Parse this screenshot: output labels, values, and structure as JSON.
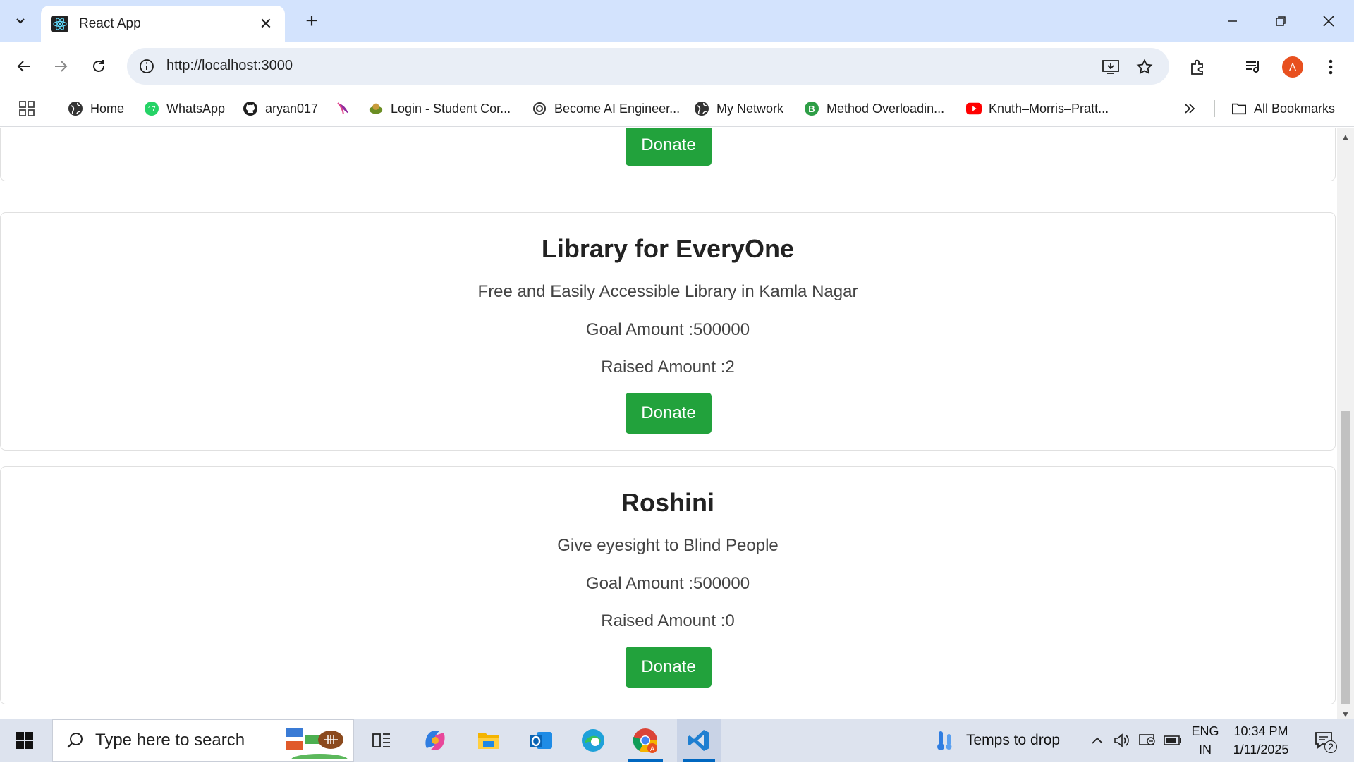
{
  "browser": {
    "tab_title": "React App",
    "url": "http://localhost:3000",
    "profile_initial": "A"
  },
  "bookmarks": {
    "items": [
      {
        "label": "Home",
        "icon": "globe-icon"
      },
      {
        "label": "WhatsApp",
        "icon": "whatsapp-icon"
      },
      {
        "label": "aryan017",
        "icon": "github-icon"
      },
      {
        "label": "",
        "icon": "bird-icon"
      },
      {
        "label": "Login - Student Cor...",
        "icon": "student-portal-icon"
      },
      {
        "label": "Become AI Engineer...",
        "icon": "openai-icon"
      },
      {
        "label": "My Network",
        "icon": "globe-icon"
      },
      {
        "label": "Method Overloadin...",
        "icon": "b-icon"
      },
      {
        "label": "Knuth–Morris–Pratt...",
        "icon": "youtube-icon"
      }
    ],
    "all_bookmarks": "All Bookmarks"
  },
  "campaigns": [
    {
      "title": "",
      "description": "",
      "goal": "",
      "raised": "",
      "donate_label": "Donate"
    },
    {
      "title": "Library for EveryOne",
      "description": "Free and Easily Accessible Library in Kamla Nagar",
      "goal": "Goal Amount :500000",
      "raised": "Raised Amount :2",
      "donate_label": "Donate"
    },
    {
      "title": "Roshini",
      "description": "Give eyesight to Blind People",
      "goal": "Goal Amount :500000",
      "raised": "Raised Amount :0",
      "donate_label": "Donate"
    }
  ],
  "taskbar": {
    "search_placeholder": "Type here to search",
    "weather": "Temps to drop",
    "lang_top": "ENG",
    "lang_bottom": "IN",
    "time": "10:34 PM",
    "date": "1/11/2025",
    "notification_count": "2"
  },
  "colors": {
    "donate_button": "#22a23c",
    "titlebar": "#d3e3fd",
    "taskbar": "#dde3ee"
  }
}
